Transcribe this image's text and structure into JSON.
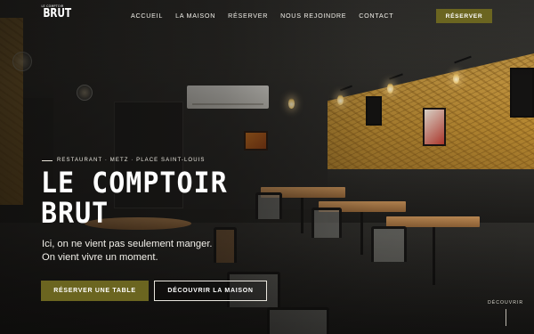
{
  "header": {
    "logo": {
      "small_text": "LE COMPTOIR",
      "big_text": "BRUT"
    },
    "nav": [
      {
        "label": "ACCUEIL"
      },
      {
        "label": "LA MAISON"
      },
      {
        "label": "RÉSERVER"
      },
      {
        "label": "NOUS REJOINDRE"
      },
      {
        "label": "CONTACT"
      }
    ],
    "cta_label": "RÉSERVER"
  },
  "hero": {
    "eyebrow": "RESTAURANT · METZ · PLACE SAINT-LOUIS",
    "title_lines": [
      "LE COMPTOIR",
      "BRUT"
    ],
    "tagline_lines": [
      "Ici, on ne vient pas seulement manger.",
      "On vient vivre un moment."
    ],
    "primary_button": "RÉSERVER UNE TABLE",
    "secondary_button": "DÉCOUVRIR LA MAISON",
    "scroll_label": "DÉCOUVRIR"
  },
  "colors": {
    "accent": "#6b6520",
    "text": "#ffffff"
  },
  "icons": {
    "scroll_indicator": "vertical-line-icon"
  }
}
